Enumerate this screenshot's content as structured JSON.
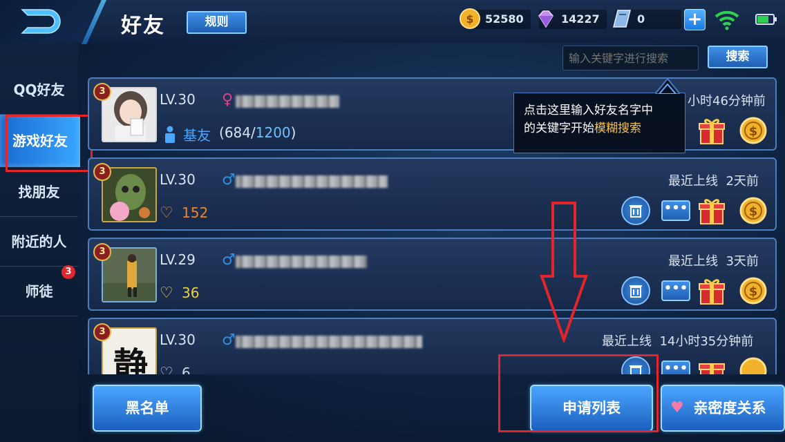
{
  "header": {
    "title": "好友",
    "rules_label": "规则",
    "currencies": [
      {
        "icon": "gold-coin-icon",
        "value": "52580"
      },
      {
        "icon": "diamond-icon",
        "value": "14227"
      },
      {
        "icon": "voucher-icon",
        "value": "0"
      }
    ],
    "plus_label": "+"
  },
  "sidebar": {
    "items": [
      {
        "label": "QQ好友"
      },
      {
        "label": "游戏好友"
      },
      {
        "label": "找朋友"
      },
      {
        "label": "附近的人"
      },
      {
        "label": "师徒"
      }
    ],
    "mentor_badge": "3"
  },
  "search": {
    "placeholder": "输入关键字进行搜索",
    "button_label": "搜索"
  },
  "tooltip": {
    "line1": "点击这里输入好友名字中",
    "line2_prefix": "的关键字开始",
    "line2_highlight": "模糊搜索"
  },
  "friends": [
    {
      "level_badge": "3",
      "level": "LV.30",
      "relation": "基友",
      "intimacy_current": "684",
      "intimacy_max": "1200",
      "status_label": "",
      "status_time": "小时46分钟前"
    },
    {
      "level_badge": "3",
      "level": "LV.30",
      "intimacy": "152",
      "status_label": "最近上线",
      "status_time": "2天前"
    },
    {
      "level_badge": "3",
      "level": "LV.29",
      "intimacy": "36",
      "status_label": "最近上线",
      "status_time": "3天前"
    },
    {
      "level_badge": "3",
      "level": "LV.30",
      "intimacy": "6",
      "status_label": "最近上线",
      "status_time": "14小时35分钟前"
    }
  ],
  "bottom": {
    "blacklist_label": "黑名单",
    "requests_label": "申请列表",
    "intimacy_label": "亲密度关系"
  },
  "colors": {
    "accent": "#3f8fe6",
    "highlight_box": "#e5252a",
    "tooltip_highlight": "#f5c342",
    "male": "#2f8fe0",
    "female": "#e0428a"
  }
}
